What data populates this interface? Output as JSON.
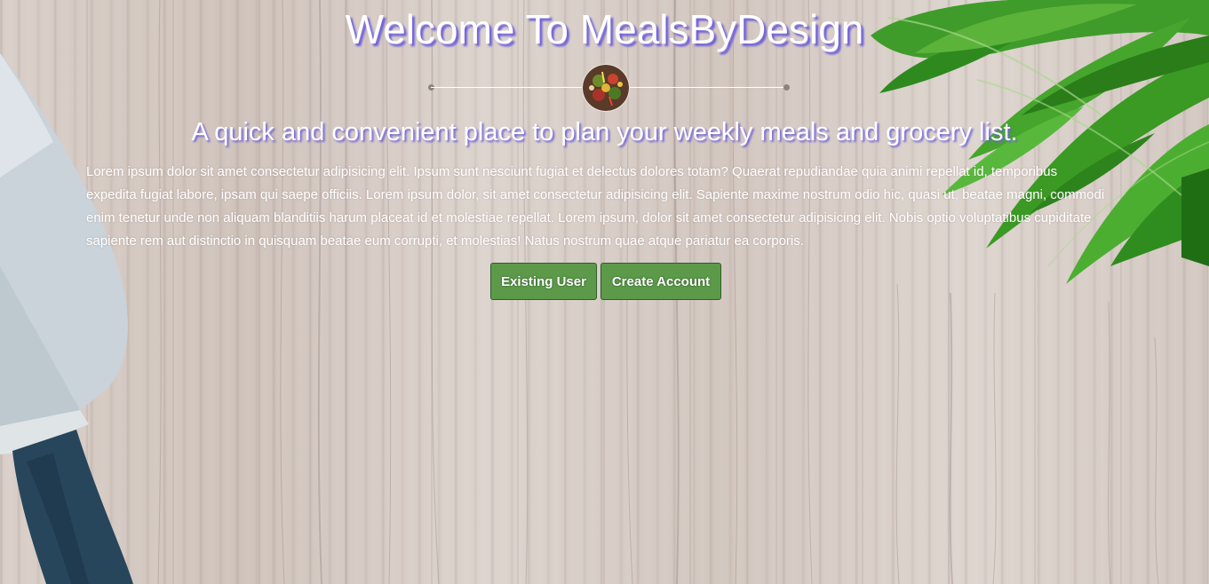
{
  "header": {
    "title": "Welcome To MealsByDesign",
    "subtitle": "A quick and convenient place to plan your weekly meals and grocery list."
  },
  "intro": {
    "body": "Lorem ipsum dolor sit amet consectetur adipisicing elit. Ipsum sunt nesciunt fugiat et delectus dolores totam? Quaerat repudiandae quia animi repellat id, temporibus expedita fugiat labore, ipsam qui saepe officiis. Lorem ipsum dolor, sit amet consectetur adipisicing elit. Sapiente maxime nostrum odio hic, quasi ut, beatae magni, commodi enim tenetur unde non aliquam blanditiis harum placeat id et molestiae repellat. Lorem ipsum, dolor sit amet consectetur adipisicing elit. Nobis optio voluptatibus cupiditate sapiente rem aut distinctio in quisquam beatae eum corrupti, et molestias! Natus nostrum quae atque pariatur ea corporis."
  },
  "actions": {
    "existing_user_label": "Existing User",
    "create_account_label": "Create Account"
  },
  "colors": {
    "title_shadow": "#6f60d8",
    "button_bg": "#5c9a4a",
    "button_border": "#2f5c2b"
  },
  "icons": [
    "food-emblem-icon",
    "knife-illustration",
    "leaves-illustration"
  ]
}
